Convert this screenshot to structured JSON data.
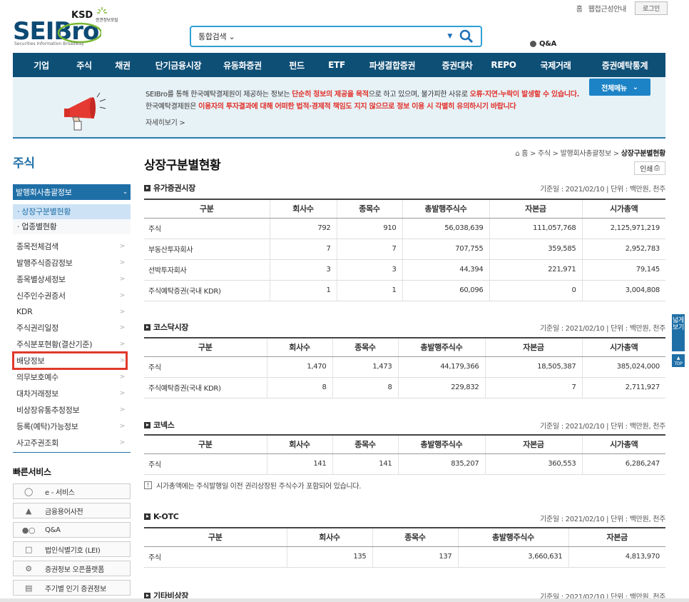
{
  "util": {
    "home": "홈",
    "sitemap": "웹접근성안내",
    "login": "로그인"
  },
  "logo": {
    "ksd": "KSD",
    "ksd_sub": "증권정보포털",
    "main_a": "SEI",
    "main_b": "Bro",
    "sub": "Securities Information Broadway"
  },
  "search": {
    "category": "통합검색",
    "qa": "Q&A"
  },
  "nav": [
    "기업",
    "주식",
    "채권",
    "단기금융시장",
    "유동화증권",
    "펀드",
    "ETF",
    "파생결합증권",
    "증권대차",
    "REPO",
    "국제거래",
    "증권예탁통계"
  ],
  "banner": {
    "l1a": "SEIBro를 통해 한국예탁결제원이 제공하는 정보는 ",
    "l1b": "단순히 정보의 제공을 목적",
    "l1c": "으로 하고 있으며, 불가피한 사유로 ",
    "l1d": "오류·지연·누락이 발생할 수 있습니다.",
    "l2a": "한국예탁결제원은 ",
    "l2b": "이용자의 투자결과에 대해 어떠한 법적·경제적 책임도 지지 않으므로 정보 이용 시 각별히 유의하시기 바랍니다",
    "more": "자세히보기  >",
    "allmenu": "전체메뉴"
  },
  "sidebar": {
    "title": "주식",
    "head": "발행회사총괄정보",
    "sub": [
      "· 상장구분별현황",
      "· 업종별현황"
    ],
    "items": [
      "종목전체검색",
      "발행주식증감정보",
      "종목별상세정보",
      "신주인수권증서",
      "KDR",
      "주식권리일정",
      "주식분포현황(결산기준)",
      "배당정보",
      "의무보호예수",
      "대차거래정보",
      "비상장유통추정정보",
      "등록(예탁)가능정보",
      "사고주권조회"
    ],
    "fast_title": "빠른서비스",
    "fast": [
      "e - 서비스",
      "금융용어사전",
      "Q&A",
      "법인식별기호 (LEI)",
      "증권정보 오픈플랫폼",
      "주기별 인기 증권정보"
    ]
  },
  "main": {
    "title": "상장구분별현황",
    "crumb_a": "홈 > 주식 > 발행회사총괄정보 > ",
    "crumb_b": "상장구분별현황",
    "print": "인쇄",
    "ref": "기준일 : 2021/02/10  |  단위 : 백만원, 천주",
    "note": "시가총액에는 주식발행일 이전 권리상장된 주식수가 포함되어 있습니다.",
    "sections": [
      {
        "title": "유가증권시장",
        "headers": [
          "구분",
          "회사수",
          "종목수",
          "총발행주식수",
          "자본금",
          "시가총액"
        ],
        "rows": [
          [
            "주식",
            "792",
            "910",
            "56,038,639",
            "111,057,768",
            "2,125,971,219"
          ],
          [
            "부동산투자회사",
            "7",
            "7",
            "707,755",
            "359,585",
            "2,952,783"
          ],
          [
            "선박투자회사",
            "3",
            "3",
            "44,394",
            "221,971",
            "79,145"
          ],
          [
            "주식예탁증권(국내 KDR)",
            "1",
            "1",
            "60,096",
            "0",
            "3,004,808"
          ]
        ]
      },
      {
        "title": "코스닥시장",
        "headers": [
          "구분",
          "회사수",
          "종목수",
          "총발행주식수",
          "자본금",
          "시가총액"
        ],
        "rows": [
          [
            "주식",
            "1,470",
            "1,473",
            "44,179,366",
            "18,505,387",
            "385,024,000"
          ],
          [
            "주식예탁증권(국내 KDR)",
            "8",
            "8",
            "229,832",
            "7",
            "2,711,927"
          ]
        ]
      },
      {
        "title": "코넥스",
        "headers": [
          "구분",
          "회사수",
          "종목수",
          "총발행주식수",
          "자본금",
          "시가총액"
        ],
        "rows": [
          [
            "주식",
            "141",
            "141",
            "835,207",
            "360,553",
            "6,286,247"
          ]
        ]
      },
      {
        "title": "K-OTC",
        "headers": [
          "구분",
          "회사수",
          "종목수",
          "총발행주식수",
          "자본금"
        ],
        "rows": [
          [
            "주식",
            "135",
            "137",
            "3,660,631",
            "4,813,970"
          ]
        ]
      },
      {
        "title": "기타비상장"
      }
    ]
  },
  "side": {
    "tab": "넓게보기",
    "top": "TOP"
  }
}
